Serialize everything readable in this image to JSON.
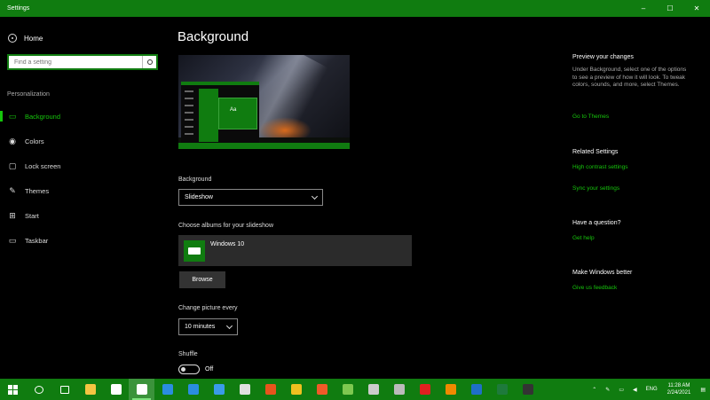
{
  "window": {
    "title": "Settings",
    "controls": [
      "–",
      "☐",
      "✕"
    ]
  },
  "sidebar": {
    "home_label": "Home",
    "search_placeholder": "Find a setting",
    "section_label": "Personalization",
    "items": [
      {
        "label": "Background",
        "icon": "picture-icon",
        "glyph": "▭",
        "active": true
      },
      {
        "label": "Colors",
        "icon": "palette-icon",
        "glyph": "◉",
        "active": false
      },
      {
        "label": "Lock screen",
        "icon": "lock-screen-icon",
        "glyph": "▢",
        "active": false
      },
      {
        "label": "Themes",
        "icon": "brush-icon",
        "glyph": "✎",
        "active": false
      },
      {
        "label": "Start",
        "icon": "start-icon",
        "glyph": "⊞",
        "active": false
      },
      {
        "label": "Taskbar",
        "icon": "taskbar-icon",
        "glyph": "▭",
        "active": false
      }
    ]
  },
  "main": {
    "title": "Background",
    "preview_tile_text": "Aa",
    "background_label": "Background",
    "background_value": "Slideshow",
    "albums_label": "Choose albums for your slideshow",
    "album_name": "Windows 10",
    "browse_label": "Browse",
    "change_label": "Change picture every",
    "change_value": "10 minutes",
    "shuffle_label": "Shuffle",
    "shuffle_state": "Off"
  },
  "right": {
    "preview_heading": "Preview your changes",
    "preview_text": "Under Background, select one of the options to see a preview of how it will look. To tweak colors, sounds, and more, select Themes.",
    "preview_link": "Go to Themes",
    "related_heading": "Related Settings",
    "related_link_1": "High contrast settings",
    "related_link_2": "Sync your settings",
    "question_heading": "Have a question?",
    "question_link": "Get help",
    "better_heading": "Make Windows better",
    "better_link": "Give us feedback"
  },
  "taskbar": {
    "apps": [
      {
        "name": "search-icon",
        "color": "transparent"
      },
      {
        "name": "task-view-icon",
        "color": "transparent"
      },
      {
        "name": "file-explorer-icon",
        "color": "#f4c542"
      },
      {
        "name": "store-icon",
        "color": "#ffffff"
      },
      {
        "name": "settings-icon",
        "color": "#ffffff",
        "active": true
      },
      {
        "name": "mail-icon",
        "color": "#2b8de0"
      },
      {
        "name": "shield-icon",
        "color": "#2b8de0"
      },
      {
        "name": "edge-icon",
        "color": "#3a9be8"
      },
      {
        "name": "paint-icon",
        "color": "#e0e0e0"
      },
      {
        "name": "firefox-icon",
        "color": "#e8541c"
      },
      {
        "name": "chrome-icon",
        "color": "#f0c020"
      },
      {
        "name": "brave-icon",
        "color": "#f05a28"
      },
      {
        "name": "photos-icon",
        "color": "#7ec850"
      },
      {
        "name": "remote-icon",
        "color": "#cccccc"
      },
      {
        "name": "printer-icon",
        "color": "#bbbbbb"
      },
      {
        "name": "acrobat-icon",
        "color": "#e02020"
      },
      {
        "name": "vlc-icon",
        "color": "#f08a00"
      },
      {
        "name": "outlook-icon",
        "color": "#1f6fc8"
      },
      {
        "name": "excel-icon",
        "color": "#1e7a3c"
      },
      {
        "name": "terminal-icon",
        "color": "#333333"
      }
    ],
    "tray_lang": "ENG",
    "time": "11:28 AM",
    "date": "2/24/2021"
  }
}
